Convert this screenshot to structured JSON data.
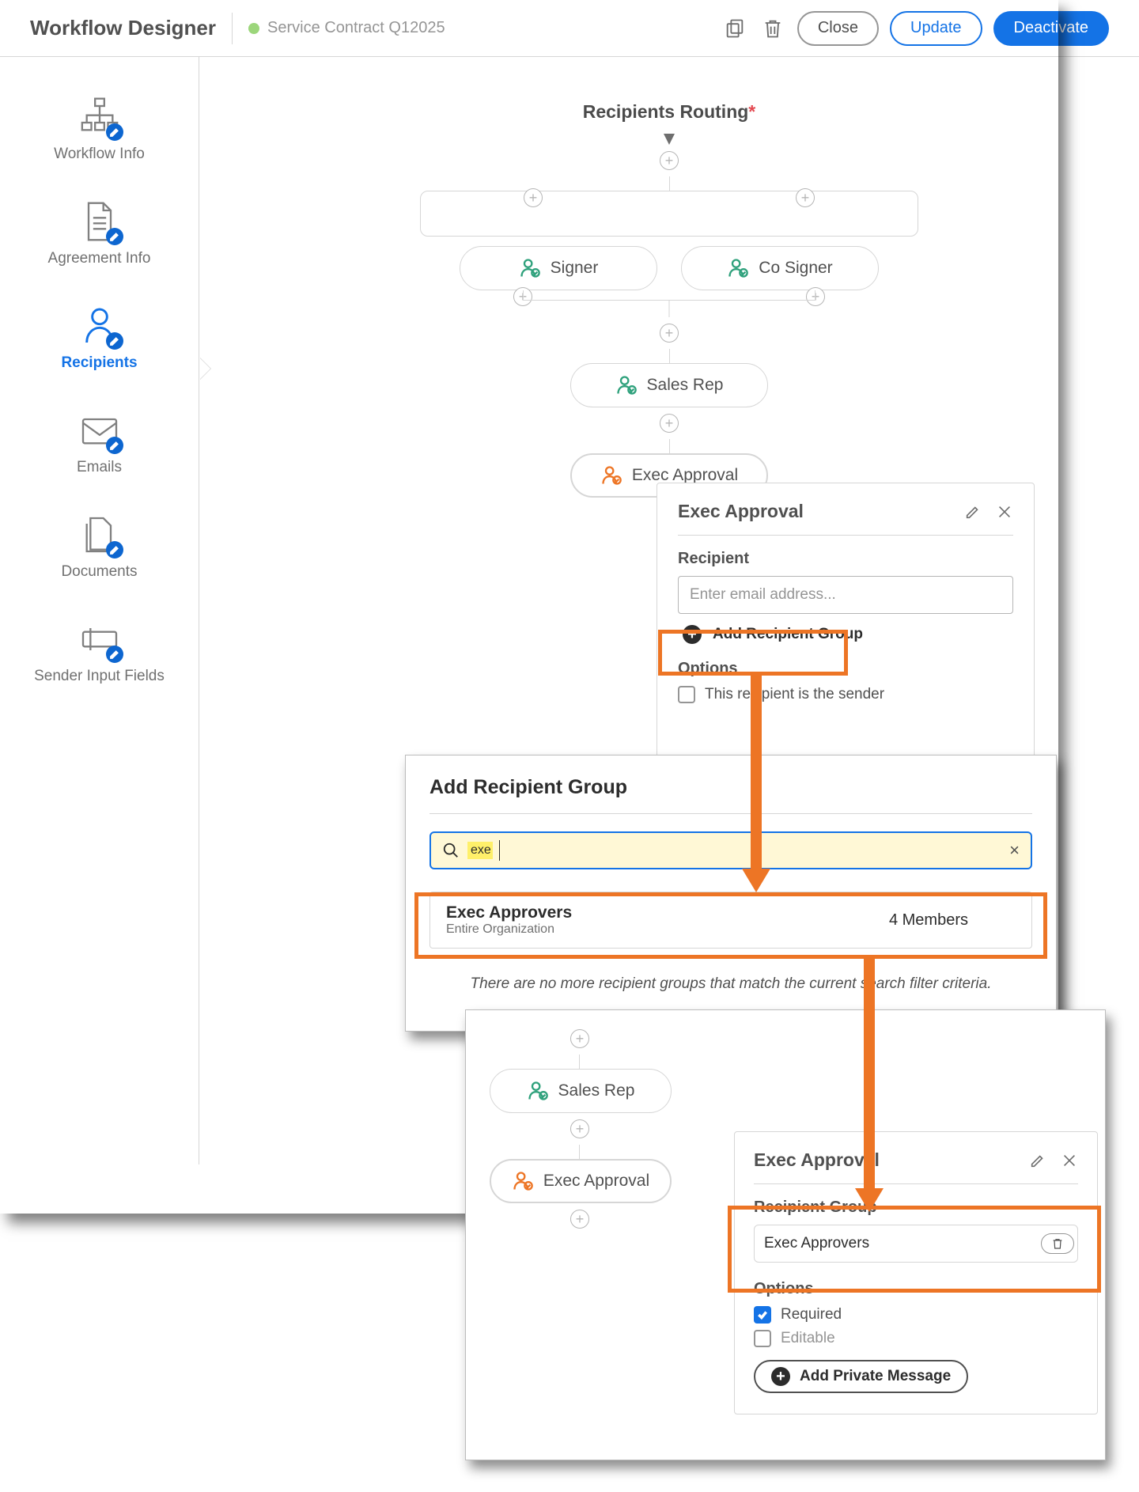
{
  "header": {
    "title": "Workflow Designer",
    "subtitle": "Service Contract Q12025",
    "close": "Close",
    "update": "Update",
    "deactivate": "Deactivate"
  },
  "sidebar": {
    "items": [
      {
        "label": "Workflow Info"
      },
      {
        "label": "Agreement Info"
      },
      {
        "label": "Recipients"
      },
      {
        "label": "Emails"
      },
      {
        "label": "Documents"
      },
      {
        "label": "Sender Input Fields"
      }
    ]
  },
  "routing": {
    "title": "Recipients Routing",
    "asterisk": "*",
    "signer": "Signer",
    "cosigner": "Co Signer",
    "salesrep": "Sales Rep",
    "execapproval": "Exec Approval"
  },
  "panel1": {
    "title": "Exec Approval",
    "recipient_label": "Recipient",
    "placeholder": "Enter email address...",
    "add_group": "Add Recipient Group",
    "options_label": "Options",
    "sender_chk": "This recipient is the sender"
  },
  "modal": {
    "title": "Add Recipient Group",
    "query": "exe",
    "result_name": "Exec Approvers",
    "result_scope": "Entire Organization",
    "result_members": "4 Members",
    "no_more": "There are no more recipient groups that match the current search filter criteria."
  },
  "panel2": {
    "title": "Exec Approval",
    "group_label": "Recipient Group",
    "group_value": "Exec Approvers",
    "options_label": "Options",
    "required": "Required",
    "editable": "Editable",
    "private_msg": "Add Private Message"
  }
}
